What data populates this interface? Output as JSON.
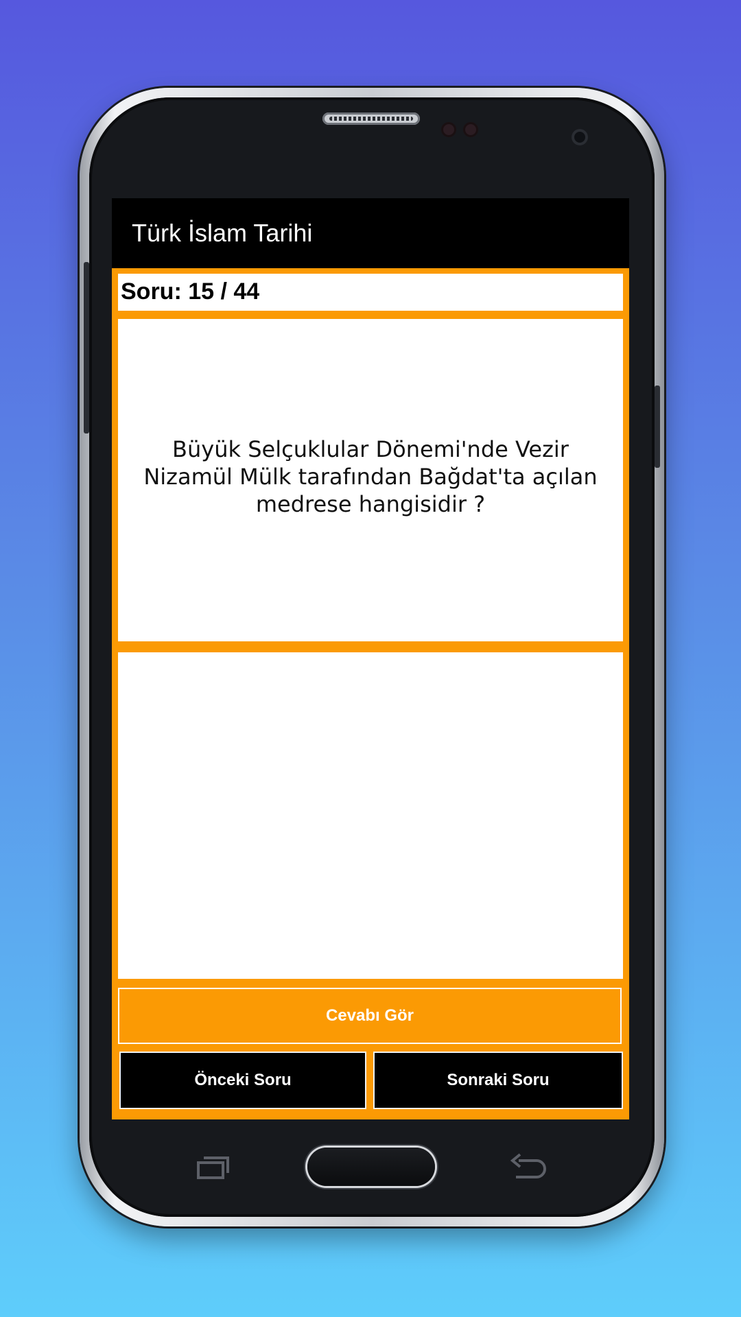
{
  "app": {
    "title": "Türk İslam Tarihi"
  },
  "quiz": {
    "counter": "Soru: 15 / 44",
    "question": "Büyük Selçuklular Dönemi'nde Vezir Nizamül Mülk tarafından Bağdat'ta açılan medrese hangisidir ?",
    "answer": ""
  },
  "buttons": {
    "show_answer": "Cevabı Gör",
    "previous": "Önceki Soru",
    "next": "Sonraki Soru"
  },
  "nav_icons": {
    "recent": "recent-apps-icon",
    "home": "home-button",
    "back": "back-icon"
  },
  "colors": {
    "accent": "#fb9a04",
    "app_bar": "#000000",
    "background_top": "#5658de",
    "background_bottom": "#5ecdfb"
  }
}
